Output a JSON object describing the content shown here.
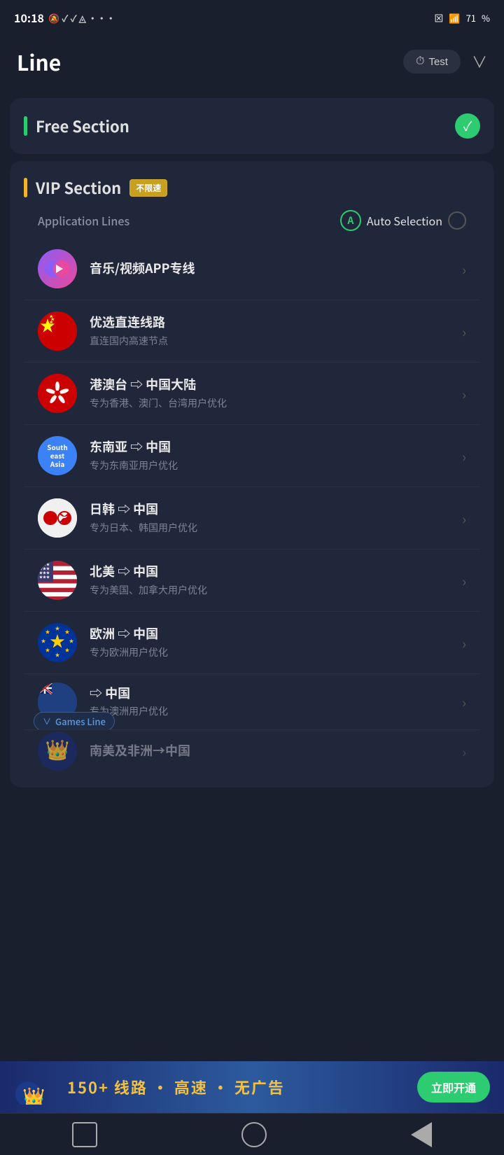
{
  "statusBar": {
    "time": "10:18",
    "battery": "71"
  },
  "header": {
    "title": "Line",
    "testLabel": "Test",
    "chevronIcon": "chevron-down"
  },
  "freeSection": {
    "title": "Free Section",
    "barColor": "green",
    "checked": true
  },
  "vipSection": {
    "title": "VIP Section",
    "badge": "不限速",
    "barColor": "yellow"
  },
  "appLines": {
    "label": "Application Lines",
    "autoSelection": "Auto Selection"
  },
  "lineItems": [
    {
      "id": "music",
      "title": "音乐/视频APP专线",
      "subtitle": "",
      "iconType": "music"
    },
    {
      "id": "china-direct",
      "title": "优选直连线路",
      "subtitle": "直连国内高速节点",
      "iconType": "china-flag"
    },
    {
      "id": "hk-mac-tw",
      "title": "港澳台 ⇨ 中国大陆",
      "subtitle": "专为香港、澳门、台湾用户优化",
      "iconType": "hk-flag"
    },
    {
      "id": "sea-china",
      "title": "东南亚 ⇨ 中国",
      "subtitle": "专为东南亚用户优化",
      "iconType": "sea-text"
    },
    {
      "id": "japan-korea",
      "title": "日韩 ⇨ 中国",
      "subtitle": "专为日本、韩国用户优化",
      "iconType": "jp-kr"
    },
    {
      "id": "north-america",
      "title": "北美 ⇨ 中国",
      "subtitle": "专为美国、加拿大用户优化",
      "iconType": "us-flag"
    },
    {
      "id": "europe",
      "title": "欧洲 ⇨ 中国",
      "subtitle": "专为欧洲用户优化",
      "iconType": "eu-flag"
    },
    {
      "id": "australia-partial",
      "title": "⇨ 中国",
      "subtitle": "专为澳洲用户优化",
      "iconType": "aus-flag",
      "partial": true
    },
    {
      "id": "africa-partial",
      "title": "南美及非洲→中国",
      "subtitle": "",
      "iconType": "crown",
      "partial": true
    }
  ],
  "gamesLineBadge": "Games Line",
  "banner": {
    "text": "150+ 线路 · 高速 · 无广告",
    "btnLabel": "立即开通",
    "crownIcon": "👑"
  },
  "bottomNav": {
    "squareIcon": "□",
    "circleIcon": "○",
    "backIcon": "◁"
  }
}
